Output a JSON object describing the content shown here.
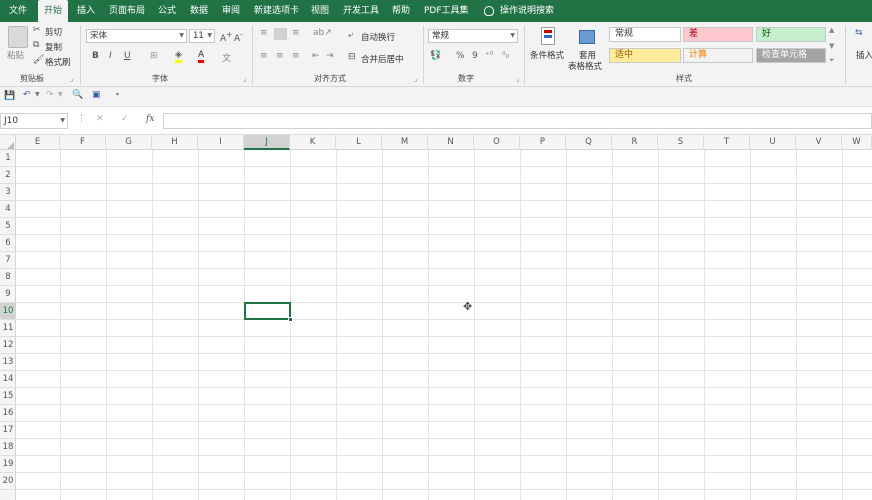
{
  "menu": {
    "tabs": [
      "文件",
      "开始",
      "插入",
      "页面布局",
      "公式",
      "数据",
      "审阅",
      "新建选项卡",
      "视图",
      "开发工具",
      "帮助",
      "PDF工具集"
    ],
    "active_tab": "开始",
    "search_label": "操作说明搜索"
  },
  "ribbon": {
    "clipboard": {
      "paste": "粘贴",
      "cut": "剪切",
      "copy": "复制",
      "format_painter": "格式刷",
      "label": "剪贴板"
    },
    "font": {
      "font_name": "宋体",
      "font_size": "11",
      "bold": "B",
      "italic": "I",
      "underline": "U",
      "label": "字体"
    },
    "alignment": {
      "wrap_text": "自动换行",
      "merge_center": "合并后居中",
      "label": "对齐方式"
    },
    "number": {
      "format": "常规",
      "label": "数字"
    },
    "styles": {
      "conditional_format": "条件格式",
      "table_format_1": "套用",
      "table_format_2": "表格格式",
      "cells": [
        {
          "text": "常规",
          "bg": "#ffffff",
          "fg": "#333333"
        },
        {
          "text": "差",
          "bg": "#ffc7ce",
          "fg": "#9c0006"
        },
        {
          "text": "好",
          "bg": "#c6efce",
          "fg": "#006100"
        },
        {
          "text": "适中",
          "bg": "#ffeb9c",
          "fg": "#9c5700"
        },
        {
          "text": "计算",
          "bg": "#f2f2f2",
          "fg": "#fa7d00"
        },
        {
          "text": "检查单元格",
          "bg": "#a5a5a5",
          "fg": "#ffffff"
        }
      ],
      "label": "样式"
    },
    "cells_group": {
      "insert": "插入"
    }
  },
  "formula_bar": {
    "name_box": "J10",
    "fx": "fx",
    "value": ""
  },
  "grid": {
    "columns": [
      "E",
      "F",
      "G",
      "H",
      "I",
      "J",
      "K",
      "L",
      "M",
      "N",
      "O",
      "P",
      "Q",
      "R",
      "S",
      "T",
      "U",
      "V",
      "W"
    ],
    "selected_column": "J",
    "rows": [
      "1",
      "2",
      "3",
      "4",
      "5",
      "6",
      "7",
      "8",
      "9",
      "10",
      "11",
      "12",
      "13",
      "14",
      "15",
      "16",
      "17",
      "18",
      "19",
      "20"
    ],
    "selected_row": "10"
  },
  "colors": {
    "accent": "#217346"
  }
}
